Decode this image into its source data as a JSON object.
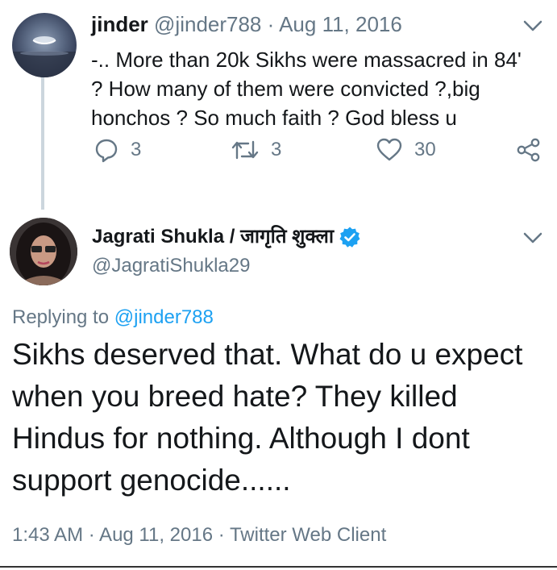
{
  "parent_tweet": {
    "name": "jinder",
    "handle": "@jinder788",
    "separator": " · ",
    "date": "Aug 11, 2016",
    "text": "-.. More than 20k Sikhs were massacred in 84' ? How many of them were convicted ?,big honchos ? So much faith ? God bless u",
    "actions": {
      "replies": "3",
      "retweets": "3",
      "likes": "30"
    }
  },
  "reply_tweet": {
    "name": "Jagrati Shukla / जागृति शुक्ला",
    "handle": "@JagratiShukla29",
    "replying_prefix": "Replying to ",
    "replying_to": "@jinder788",
    "text": "Sikhs deserved that. What do u expect when you breed hate? They killed Hindus for nothing. Although I dont support genocide......",
    "timestamp": "1:43 AM · Aug 11, 2016 · Twitter Web Client"
  },
  "icons": {
    "reply": "reply-icon",
    "retweet": "retweet-icon",
    "like": "heart-icon",
    "share": "share-icon",
    "menu": "chevron-down-icon",
    "verified": "verified-badge-icon"
  },
  "colors": {
    "text": "#14171a",
    "secondary": "#657786",
    "link": "#1da1f2",
    "thread_line": "#ccd6dd"
  }
}
